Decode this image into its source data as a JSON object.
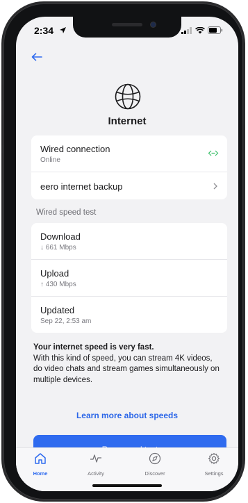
{
  "status_bar": {
    "time": "2:34"
  },
  "header": {
    "title": "Internet"
  },
  "connection_card": {
    "wired_title": "Wired connection",
    "wired_status": "Online",
    "backup_label": "eero internet backup"
  },
  "speed_section": {
    "label": "Wired speed test",
    "download_label": "Download",
    "download_value": "↓ 661 Mbps",
    "upload_label": "Upload",
    "upload_value": "↑ 430 Mbps",
    "updated_label": "Updated",
    "updated_value": "Sep 22, 2:53 am"
  },
  "info": {
    "headline": "Your internet speed is very fast.",
    "body": "With this kind of speed, you can stream 4K videos, do video chats and stream games simultaneously on multiple devices."
  },
  "learn_link": "Learn more about speeds",
  "run_button": "Run speed test",
  "tabs": [
    {
      "label": "Home",
      "icon": "home-icon",
      "active": true
    },
    {
      "label": "Activity",
      "icon": "activity-icon",
      "active": false
    },
    {
      "label": "Discover",
      "icon": "compass-icon",
      "active": false
    },
    {
      "label": "Settings",
      "icon": "gear-icon",
      "active": false
    }
  ],
  "colors": {
    "accent": "#2f6bef",
    "online": "#3bbf6a",
    "background": "#f2f2f4"
  }
}
